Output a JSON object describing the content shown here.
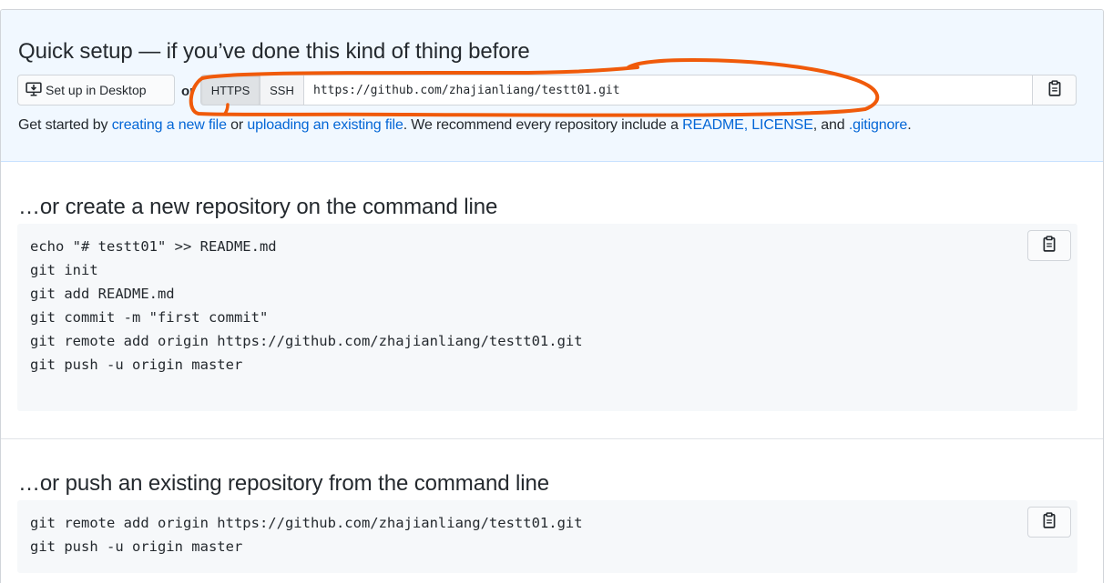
{
  "quick_setup": {
    "heading": "Quick setup — if you’ve done this kind of thing before",
    "desktop_button": "Set up in Desktop",
    "or": "or",
    "https_label": "HTTPS",
    "ssh_label": "SSH",
    "clone_url": "https://github.com/zhajianliang/testt01.git",
    "help": {
      "t1": "Get started by ",
      "link_create": "creating a new file",
      "t2": " or ",
      "link_upload": "uploading an existing file",
      "t3": ". We recommend every repository include a ",
      "link_readme": "README",
      "t4": ", ",
      "link_license": "LICENSE",
      "t5": ", and ",
      "link_gitignore": ".gitignore",
      "t6": "."
    }
  },
  "create_section": {
    "heading": "…or create a new repository on the command line",
    "lines": [
      "echo \"# testt01\" >> README.md",
      "git init",
      "git add README.md",
      "git commit -m \"first commit\"",
      "git remote add origin https://github.com/zhajianliang/testt01.git",
      "git push -u origin master"
    ]
  },
  "push_section": {
    "heading": "…or push an existing repository from the command line",
    "lines": [
      "git remote add origin https://github.com/zhajianliang/testt01.git",
      "git push -u origin master"
    ]
  },
  "colors": {
    "link": "#0366d6",
    "quick_bg": "#f1f8ff",
    "code_bg": "#f6f8fa",
    "annotation": "#f05a0a"
  },
  "icons": {
    "desktop": "desktop-download-icon",
    "copy": "clippy-icon"
  }
}
